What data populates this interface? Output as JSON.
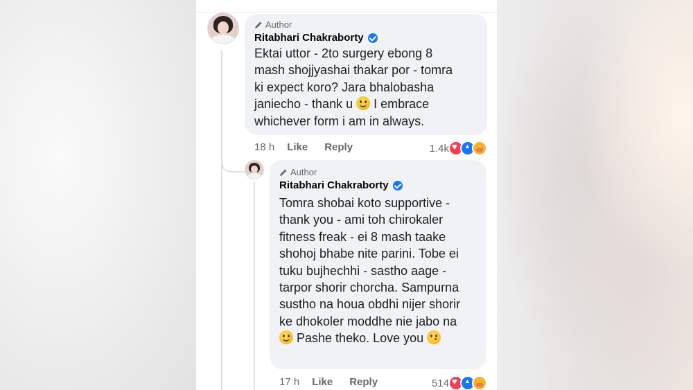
{
  "comment": {
    "badge": "Author",
    "name": "Ritabhari Chakraborty",
    "lines": [
      "Ektai uttor - 2to surgery ebong 8",
      "mash shojjyashai thakar por - tomra",
      "ki expect koro? Jara bhalobasha",
      "janiecho - thank u",
      "I embrace",
      "whichever form i am in always."
    ],
    "time": "18 h",
    "like": "Like",
    "reply": "Reply",
    "reaction_count": "1.4k"
  },
  "reply": {
    "badge": "Author",
    "name": "Ritabhari Chakraborty",
    "lines": [
      "Tomra shobai koto supportive -",
      "thank you - ami toh chirokaler",
      "fitness freak - ei 8 mash taake",
      "shohoj bhabe nite parini. Tobe ei",
      "tuku bujhechhi - sastho aage -",
      "tarpor shorir chorcha. Sampurna",
      "sustho na houa obdhi nijer shorir",
      "ke dhokoler moddhe nie jabo na",
      "Pashe theko. Love you"
    ],
    "time": "17 h",
    "like": "Like",
    "reply": "Reply",
    "reaction_count": "514"
  },
  "icons": {
    "verified": "verified-badge-icon",
    "badge": "pencil-icon",
    "reactions": [
      "love-icon",
      "like-icon",
      "care-icon"
    ]
  },
  "colors": {
    "bubble": "#f0f2f5",
    "verified": "#1877f2",
    "love": "#f33e58",
    "meta_text": "#65676b"
  }
}
